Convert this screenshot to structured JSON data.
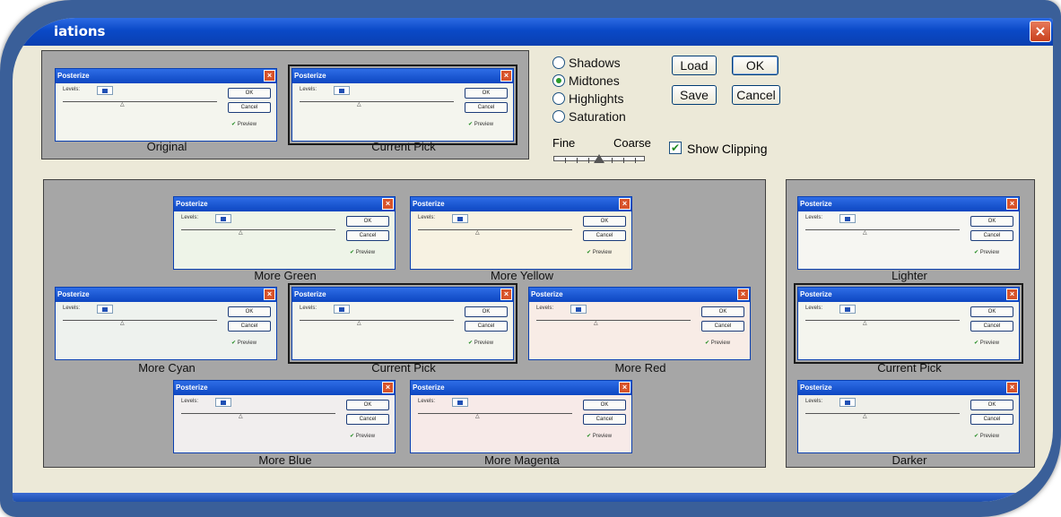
{
  "window": {
    "title": "iations",
    "close_glyph": "×"
  },
  "mini_dialog": {
    "title": "Posterize",
    "levels_label": "Levels:",
    "ok": "OK",
    "cancel": "Cancel",
    "preview": "✔ Preview",
    "close_glyph": "×"
  },
  "top_thumbs": {
    "original": "Original",
    "current_pick": "Current Pick"
  },
  "options": {
    "radios": [
      "Shadows",
      "Midtones",
      "Highlights",
      "Saturation"
    ],
    "selected": "Midtones",
    "fine": "Fine",
    "coarse": "Coarse",
    "show_clipping": "Show Clipping",
    "show_clipping_checked": true,
    "slider_level_fraction": 0.5
  },
  "buttons": {
    "load": "Load",
    "ok": "OK",
    "save": "Save",
    "cancel": "Cancel"
  },
  "color_variations": {
    "more_green": "More Green",
    "more_yellow": "More Yellow",
    "more_cyan": "More Cyan",
    "current_pick": "Current Pick",
    "more_red": "More Red",
    "more_blue": "More Blue",
    "more_magenta": "More Magenta"
  },
  "brightness_variations": {
    "lighter": "Lighter",
    "current_pick": "Current Pick",
    "darker": "Darker"
  },
  "colors": {
    "panel": "#a6a6a6",
    "title_blue": "#0a49c7",
    "frame": "#3a5f99",
    "dialog_bg": "#ece9d8"
  }
}
